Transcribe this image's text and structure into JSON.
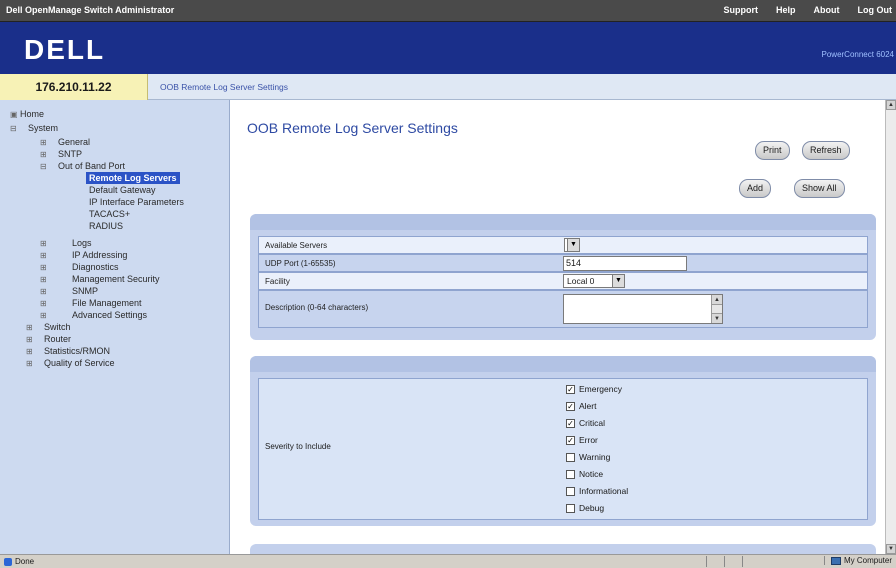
{
  "topbar": {
    "title": "Dell OpenManage Switch Administrator",
    "links": [
      "Support",
      "Help",
      "About",
      "Log Out"
    ]
  },
  "header": {
    "logo": "DELL",
    "product": "PowerConnect 6024"
  },
  "ipbar": {
    "ip": "176.210.11.22",
    "breadcrumb": "OOB Remote Log Server Settings"
  },
  "sidebar": {
    "items": [
      {
        "label": "Home",
        "exp": ""
      },
      {
        "label": "System",
        "exp": "⊟"
      },
      {
        "label": "General",
        "exp": "⊞"
      },
      {
        "label": "SNTP",
        "exp": "⊞"
      },
      {
        "label": "Out of Band Port",
        "exp": "⊟"
      },
      {
        "label": "Remote Log Servers",
        "exp": ""
      },
      {
        "label": "Default Gateway",
        "exp": ""
      },
      {
        "label": "IP Interface Parameters",
        "exp": ""
      },
      {
        "label": "TACACS+",
        "exp": ""
      },
      {
        "label": "RADIUS",
        "exp": ""
      },
      {
        "label": "Logs",
        "exp": "⊞"
      },
      {
        "label": "IP Addressing",
        "exp": "⊞"
      },
      {
        "label": "Diagnostics",
        "exp": "⊞"
      },
      {
        "label": "Management Security",
        "exp": "⊞"
      },
      {
        "label": "SNMP",
        "exp": "⊞"
      },
      {
        "label": "File Management",
        "exp": "⊞"
      },
      {
        "label": "Advanced Settings",
        "exp": "⊞"
      },
      {
        "label": "Switch",
        "exp": "⊞"
      },
      {
        "label": "Router",
        "exp": "⊞"
      },
      {
        "label": "Statistics/RMON",
        "exp": "⊞"
      },
      {
        "label": "Quality of Service",
        "exp": "⊞"
      }
    ]
  },
  "main": {
    "title": "OOB Remote Log Server Settings",
    "buttons": {
      "print": "Print",
      "refresh": "Refresh",
      "add": "Add",
      "show_all": "Show All"
    },
    "form": {
      "available_servers_label": "Available Servers",
      "available_servers_value": "",
      "udp_port_label": "UDP Port (1-65535)",
      "udp_port_value": "514",
      "facility_label": "Facility",
      "facility_value": "Local 0",
      "description_label": "Description (0-64 characters)",
      "description_value": ""
    },
    "severity": {
      "label": "Severity to Include",
      "levels": [
        {
          "name": "Emergency",
          "checked": true
        },
        {
          "name": "Alert",
          "checked": true
        },
        {
          "name": "Critical",
          "checked": true
        },
        {
          "name": "Error",
          "checked": true
        },
        {
          "name": "Warning",
          "checked": false
        },
        {
          "name": "Notice",
          "checked": false
        },
        {
          "name": "Informational",
          "checked": false
        },
        {
          "name": "Debug",
          "checked": false
        }
      ]
    }
  },
  "statusbar": {
    "status": "Done",
    "zone": "My Computer"
  }
}
